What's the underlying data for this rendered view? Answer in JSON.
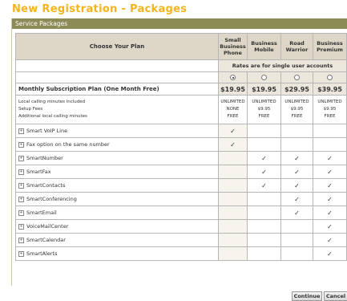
{
  "page": {
    "title": "New Registration - Packages"
  },
  "section": {
    "header": "Service Packages"
  },
  "table": {
    "choose_label": "Choose Your Plan",
    "plans": [
      {
        "name": "Small Business Phone",
        "price": "$19.95",
        "selected": true
      },
      {
        "name": "Business Mobile",
        "price": "$19.95",
        "selected": false
      },
      {
        "name": "Road Warrior",
        "price": "$29.95",
        "selected": false
      },
      {
        "name": "Business Premium",
        "price": "$39.95",
        "selected": false
      }
    ],
    "rates_note": "Rates are for single user accounts",
    "subscription_label": "Monthly Subscription Plan (One Month Free)",
    "detail_labels": [
      "Local calling minutes included",
      "Setup Fees",
      "Additional local calling minutes"
    ],
    "details": [
      [
        "UNLIMITED",
        "NONE",
        "FREE"
      ],
      [
        "UNLIMITED",
        "$9.95",
        "FREE"
      ],
      [
        "UNLIMITED",
        "$9.95",
        "FREE"
      ],
      [
        "UNLIMITED",
        "$9.95",
        "FREE"
      ]
    ],
    "check_mark": "✓",
    "features": [
      {
        "name": "Smart VoIP Line",
        "included": [
          true,
          false,
          false,
          false
        ]
      },
      {
        "name": "Fax option on the same number",
        "included": [
          true,
          false,
          false,
          false
        ]
      },
      {
        "name": "SmartNumber",
        "included": [
          false,
          true,
          true,
          true
        ]
      },
      {
        "name": "SmartFax",
        "included": [
          false,
          true,
          true,
          true
        ]
      },
      {
        "name": "SmartContacts",
        "included": [
          false,
          true,
          true,
          true
        ]
      },
      {
        "name": "SmartConferencing",
        "included": [
          false,
          false,
          true,
          true
        ]
      },
      {
        "name": "SmartEmail",
        "included": [
          false,
          false,
          true,
          true
        ]
      },
      {
        "name": "VoiceMailCenter",
        "included": [
          false,
          false,
          false,
          true
        ]
      },
      {
        "name": "SmartCalendar",
        "included": [
          false,
          false,
          false,
          true
        ]
      },
      {
        "name": "SmartAlerts",
        "included": [
          false,
          false,
          false,
          true
        ]
      }
    ]
  },
  "buttons": {
    "continue": "Continue",
    "cancel": "Cancel"
  },
  "colors": {
    "title": "#f4b41a",
    "header_bar": "#8b8b56",
    "table_head": "#ded6c6"
  }
}
